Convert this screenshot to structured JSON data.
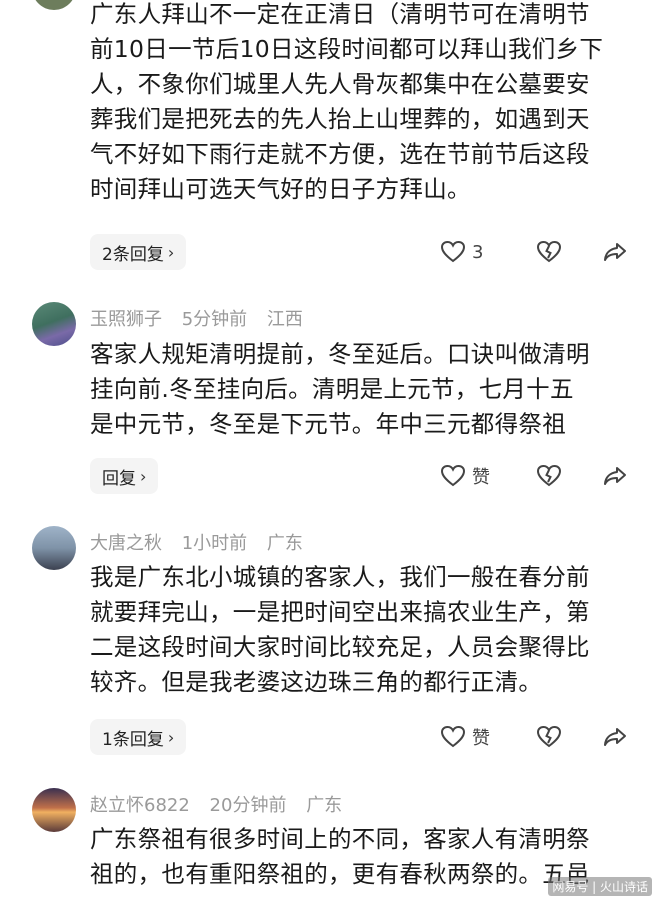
{
  "comments": [
    {
      "author": "",
      "time": "",
      "location": "",
      "text_lines": [
        "广东人拜山不一定在正清日（清明节可在清明节",
        "前10日一节后10日这段时间都可以拜山我们乡下",
        "人，不象你们城里人先人骨灰都集中在公墓要安",
        "葬我们是把死去的先人抬上山埋葬的，如遇到天",
        "气不好如下雨行走就不方便，选在节前节后这段",
        "时间拜山可选天气好的日子方拜山。"
      ],
      "reply_label": "2条回复",
      "like_label": "3"
    },
    {
      "author": "玉照狮子",
      "time": "5分钟前",
      "location": "江西",
      "text_lines": [
        "客家人规矩清明提前，冬至延后。口诀叫做清明",
        "挂向前.冬至挂向后。清明是上元节，七月十五",
        "是中元节，冬至是下元节。年中三元都得祭祖"
      ],
      "reply_label": "回复",
      "like_label": "赞"
    },
    {
      "author": "大唐之秋",
      "time": "1小时前",
      "location": "广东",
      "text_lines": [
        "我是广东北小城镇的客家人，我们一般在春分前",
        "就要拜完山，一是把时间空出来搞农业生产，第",
        "二是这段时间大家时间比较充足，人员会聚得比",
        "较齐。但是我老婆这边珠三角的都行正清。"
      ],
      "reply_label": "1条回复",
      "like_label": "赞"
    },
    {
      "author": "赵立怀6822",
      "time": "20分钟前",
      "location": "广东",
      "text_lines": [
        "广东祭祖有很多时间上的不同，客家人有清明祭",
        "祖的，也有重阳祭祖的，更有春秋两祭的。五邑"
      ]
    }
  ],
  "watermark": "网易号 | 火山诗话",
  "icons": {
    "like": "heart-outline-icon",
    "dislike": "broken-heart-icon",
    "share": "share-arrow-icon",
    "chevron": "chevron-right-icon"
  },
  "colors": {
    "meta": "#9a9a9a",
    "text": "#1a1a1a",
    "reply_bg": "#f4f4f4"
  }
}
